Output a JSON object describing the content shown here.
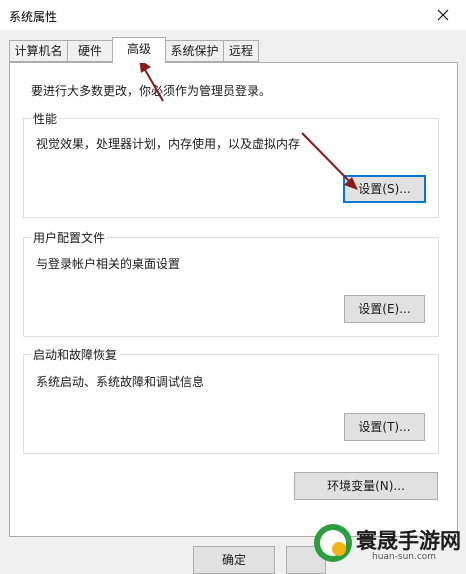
{
  "window": {
    "title": "系统属性"
  },
  "tabs": [
    {
      "label": "计算机名"
    },
    {
      "label": "硬件"
    },
    {
      "label": "高级"
    },
    {
      "label": "系统保护"
    },
    {
      "label": "远程"
    }
  ],
  "active_tab": "高级",
  "notice": "要进行大多数更改，你必须作为管理员登录。",
  "groups": {
    "performance": {
      "title": "性能",
      "description": "视觉效果，处理器计划，内存使用，以及虚拟内存",
      "button": "设置(S)..."
    },
    "user_profile": {
      "title": "用户配置文件",
      "description": "与登录帐户相关的桌面设置",
      "button": "设置(E)..."
    },
    "startup": {
      "title": "启动和故障恢复",
      "description": "系统启动、系统故障和调试信息",
      "button": "设置(T)..."
    }
  },
  "env_button": "环境变量(N)...",
  "bottom_buttons": {
    "ok": "确定"
  },
  "watermark": {
    "brand": "寰晟手游网",
    "url": "huan-sun.com"
  },
  "colors": {
    "arrow": "#8b1a1a",
    "focus": "#0078d7",
    "logo": "#2b9e3e"
  }
}
